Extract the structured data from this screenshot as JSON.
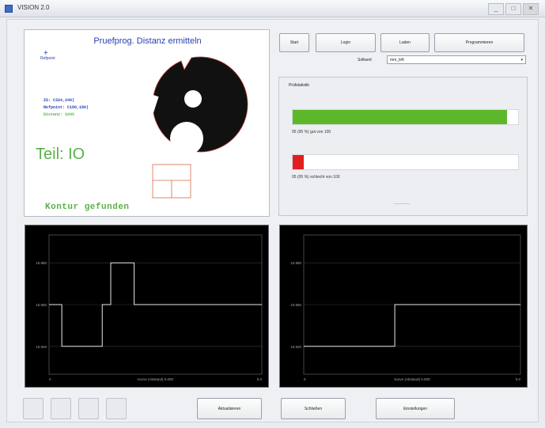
{
  "window": {
    "title": "VISION 2.0",
    "min": "_",
    "max": "□",
    "close": "✕"
  },
  "camera": {
    "title": "Pruefprog. Distanz ermitteln",
    "reference_mark": "+",
    "reference_label": "Refpoint",
    "info_lines": [
      "ZS: C324,240)",
      "Refpoint: C180,180)",
      "Distanz: 104%"
    ],
    "status": "Teil: IO",
    "message": "Kontur gefunden"
  },
  "toolbar": {
    "start": "Start",
    "login": "Login",
    "laden": "Laden",
    "programmieren": "Programmieren"
  },
  "selection": {
    "label": "Sollwert",
    "value": "mm_left"
  },
  "stats": {
    "title": "Prüfstatistik",
    "good": {
      "label": "95 (95 %) gut von 100",
      "fraction": 0.95,
      "color": "#5cb82a"
    },
    "bad": {
      "label": "05 (05 %) schlecht von 100",
      "fraction": 0.05,
      "color": "#e02020"
    }
  },
  "plot_left": {
    "yticks": [
      "10.980",
      "10.950",
      "10.920"
    ],
    "xticks": [
      "0",
      "0.0"
    ],
    "xlabel": "Kurve (Abstand) 0.000",
    "chart_data": {
      "type": "line",
      "x": [
        0,
        1,
        2,
        3,
        4,
        5
      ],
      "values": [
        10.95,
        10.92,
        10.95,
        10.98,
        10.95,
        10.95
      ]
    }
  },
  "plot_right": {
    "yticks": [
      "10.980",
      "10.950",
      "10.920"
    ],
    "xticks": [
      "0",
      "0.0"
    ],
    "xlabel": "Kurve (Abstand) 0.000",
    "chart_data": {
      "type": "line",
      "x": [
        0,
        1,
        2
      ],
      "values": [
        10.92,
        10.95,
        10.95
      ]
    }
  },
  "bottom": {
    "aktualisieren": "Aktualisieren",
    "schliessen": "Schließen",
    "einstellungen": "Einstellungen"
  }
}
